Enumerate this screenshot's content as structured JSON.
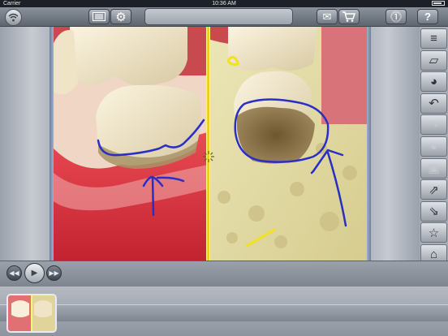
{
  "status_bar": {
    "carrier": "Carrier",
    "time": "10:36 AM"
  },
  "toolbar": {
    "left_icons": [
      "wifi-icon",
      "film-icon",
      "gear-icon"
    ],
    "right_icons": [
      "mail-icon",
      "cart-icon",
      "download-icon",
      "help-icon"
    ],
    "help_label": "?"
  },
  "tools": [
    {
      "name": "menu-lines-icon",
      "glyph": "≡",
      "enabled": true
    },
    {
      "name": "eraser-icon",
      "glyph": "▱",
      "enabled": true
    },
    {
      "name": "color-wheel-icon",
      "glyph": "◕",
      "enabled": true
    },
    {
      "name": "undo-icon",
      "glyph": "↶",
      "enabled": true
    },
    {
      "name": "redo-icon",
      "glyph": "↷",
      "enabled": false
    },
    {
      "name": "user-icon",
      "glyph": "●",
      "enabled": false
    },
    {
      "name": "save-icon",
      "glyph": "▣",
      "enabled": false
    },
    {
      "name": "export-image-icon",
      "glyph": "⇗",
      "enabled": true
    },
    {
      "name": "import-image-icon",
      "glyph": "⇘",
      "enabled": true
    },
    {
      "name": "star-icon",
      "glyph": "☆",
      "enabled": true
    },
    {
      "name": "home-icon",
      "glyph": "⌂",
      "enabled": true
    }
  ],
  "playback": {
    "prev": "◀◀",
    "play": "▶",
    "next": "▶▶"
  },
  "colors": {
    "annotation_blue": "#2a2fc4",
    "annotation_yellow": "#f2e21c",
    "divider": "#fff27a"
  }
}
